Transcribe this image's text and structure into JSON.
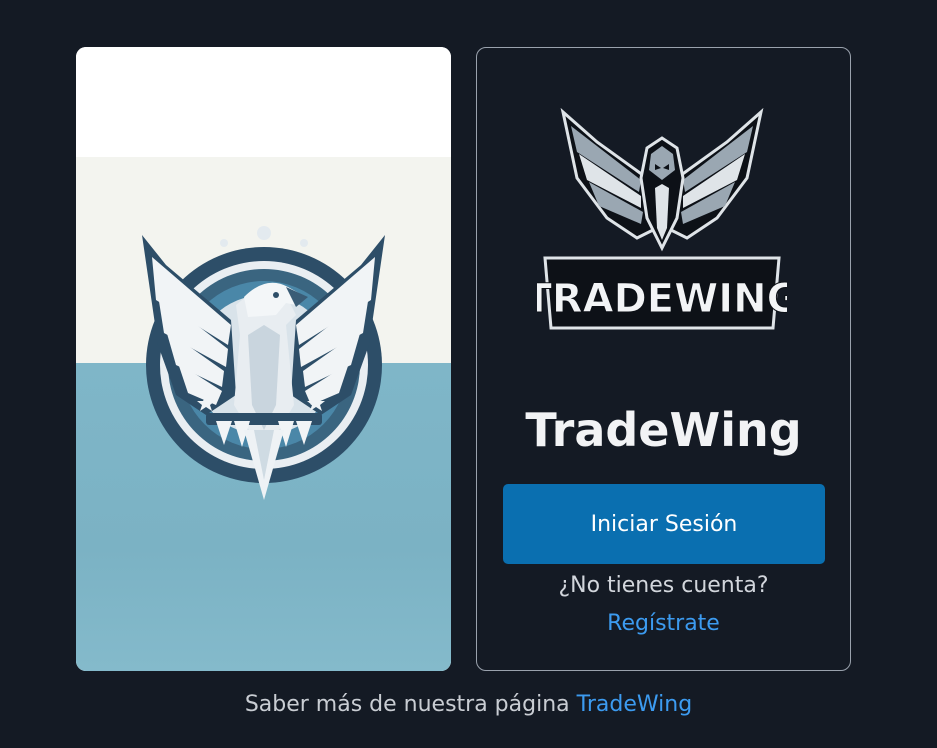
{
  "image_card": {
    "image_name": "tradewing-eagle-emblem",
    "colors": {
      "top": "#ffffff",
      "middle": "#f3f4ef",
      "bottom": "#7fb6c8"
    }
  },
  "login_card": {
    "logo_icon": "tradewing-eagle-logo",
    "logo_text": "TRADEWING",
    "title": "TradeWing",
    "login_button_label": "Iniciar Sesión",
    "no_account_text": "¿No tienes cuenta?",
    "register_link_label": "Regístrate",
    "colors": {
      "button": "#0a6fb0",
      "link": "#3c9bf0",
      "border": "#9aa2ad"
    }
  },
  "footer": {
    "text": "Saber más de nuestra página",
    "link_label": "TradeWing"
  },
  "theme": {
    "background": "#141a24",
    "text": "#f2f3f5"
  }
}
